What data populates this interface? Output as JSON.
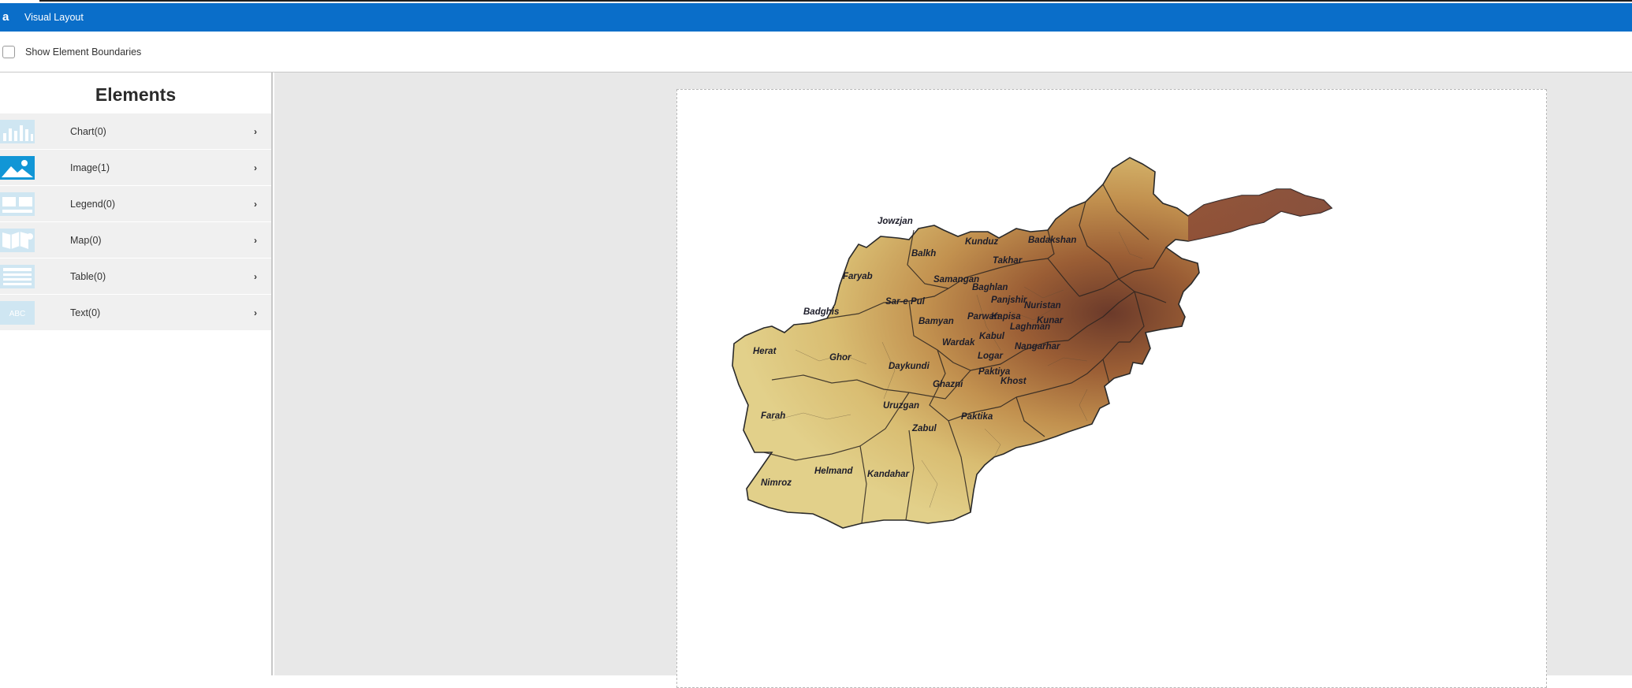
{
  "window": {
    "title": "Visual Layout",
    "app_icon": "app-logo-icon"
  },
  "toolbar": {
    "show_boundaries_label": "Show Element Boundaries",
    "show_boundaries_checked": false
  },
  "sidebar": {
    "title": "Elements",
    "items": [
      {
        "label": "Chart(0)",
        "icon": "chart-icon",
        "active": false
      },
      {
        "label": "Image(1)",
        "icon": "image-icon",
        "active": true
      },
      {
        "label": "Legend(0)",
        "icon": "legend-icon",
        "active": false
      },
      {
        "label": "Map(0)",
        "icon": "map-icon",
        "active": false
      },
      {
        "label": "Table(0)",
        "icon": "table-icon",
        "active": false
      },
      {
        "label": "Text(0)",
        "icon": "text-icon",
        "active": false
      }
    ],
    "text_icon_glyph": "ABC",
    "chevron": "›"
  },
  "colors": {
    "accent": "#0a6ec9",
    "icon_active": "#1196d6",
    "icon_inactive": "#bcdcec",
    "canvas_bg": "#e8e8e8"
  },
  "map": {
    "provinces": [
      "Jowzjan",
      "Balkh",
      "Kunduz",
      "Badakshan",
      "Takhar",
      "Faryab",
      "Samangan",
      "Baghlan",
      "Panjshir",
      "Nuristan",
      "Sar-e Pul",
      "Badghis",
      "Bamyan",
      "Parwan",
      "Kapisa",
      "Kunar",
      "Laghman",
      "Kabul",
      "Wardak",
      "Nangarhar",
      "Herat",
      "Ghor",
      "Daykundi",
      "Logar",
      "Paktiya",
      "Khost",
      "Ghazni",
      "Uruzgan",
      "Paktika",
      "Farah",
      "Zabul",
      "Helmand",
      "Kandahar",
      "Nimroz"
    ]
  }
}
